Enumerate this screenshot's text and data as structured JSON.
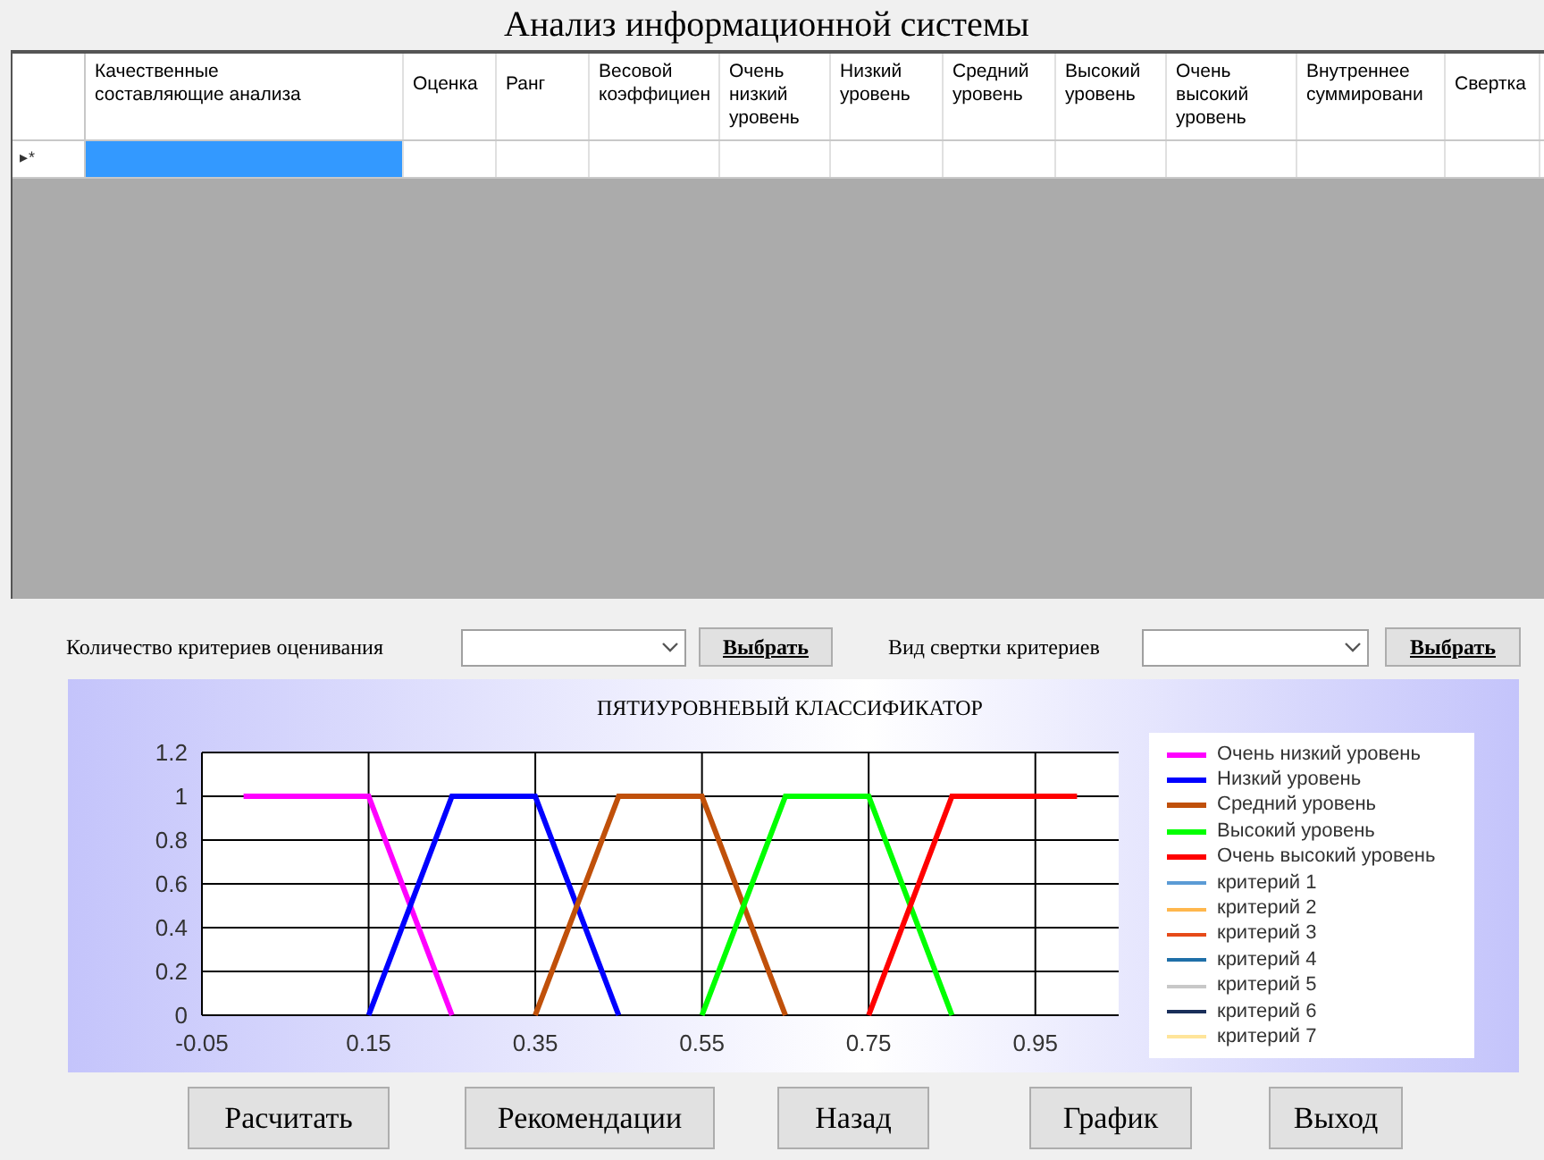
{
  "window": {
    "title": "Анализ информационной системы"
  },
  "grid": {
    "columns": [
      "Качественные\nсоставляющие анализа",
      "Оценка",
      "Ранг",
      "Весовой\nкоэффициен",
      "Очень\nнизкий\nуровень",
      "Низкий\nуровень",
      "Средний\nуровень",
      "Высокий\nуровень",
      "Очень\nвысокий\nуровень",
      "Внутреннее\nсуммировани",
      "Свертка"
    ],
    "new_row": {
      "marker": "▸*",
      "cells": [
        {
          "selected": true
        },
        {
          "selected": false
        },
        {
          "selected": false
        },
        {
          "selected": false
        },
        {
          "selected": false
        },
        {
          "selected": false
        },
        {
          "selected": false
        },
        {
          "selected": false
        },
        {
          "selected": false
        },
        {
          "selected": false
        },
        {
          "selected": false
        }
      ]
    }
  },
  "controls": [
    {
      "label": "Количество критериев оценивания",
      "button": "Выбрать"
    },
    {
      "label": "Вид свертки критериев",
      "button": "Выбрать"
    }
  ],
  "chart": {
    "chart_data": {
      "type": "line",
      "title": "ПЯТИУРОВНЕВЫЙ КЛАССИФИКАТОР",
      "x": [
        0,
        0.15,
        0.25,
        0.35,
        0.45,
        0.55,
        0.65,
        0.75,
        0.85,
        1.0
      ],
      "xlim": [
        -0.05,
        1.05
      ],
      "ylim": [
        0,
        1.2
      ],
      "xticks": [
        -0.05,
        0.15,
        0.35,
        0.55,
        0.75,
        0.95
      ],
      "yticks": [
        0,
        0.2,
        0.4,
        0.6,
        0.8,
        1,
        1.2
      ],
      "grid": true,
      "legend": "right",
      "series": [
        {
          "name": "Очень низкий уровень",
          "color": "#ff00ff",
          "values": [
            1,
            1,
            0,
            null,
            null,
            null,
            null,
            null,
            null,
            null
          ]
        },
        {
          "name": "Низкий уровень",
          "color": "#0000ff",
          "values": [
            null,
            0,
            1,
            1,
            0,
            null,
            null,
            null,
            null,
            null
          ]
        },
        {
          "name": "Средний уровень",
          "color": "#c0500a",
          "values": [
            null,
            null,
            null,
            0,
            1,
            1,
            0,
            null,
            null,
            null
          ]
        },
        {
          "name": "Высокий уровень",
          "color": "#00ff00",
          "values": [
            null,
            null,
            null,
            null,
            null,
            0,
            1,
            1,
            0,
            null
          ]
        },
        {
          "name": "Очень высокий уровень",
          "color": "#ff0000",
          "values": [
            null,
            null,
            null,
            null,
            null,
            null,
            null,
            0,
            1,
            1
          ]
        },
        {
          "name": "критерий 1",
          "color": "#5b9bd5",
          "values": [
            null,
            null,
            null,
            null,
            null,
            null,
            null,
            null,
            null,
            null
          ]
        },
        {
          "name": "критерий 2",
          "color": "#ffb74d",
          "values": [
            null,
            null,
            null,
            null,
            null,
            null,
            null,
            null,
            null,
            null
          ]
        },
        {
          "name": "критерий 3",
          "color": "#e64a19",
          "values": [
            null,
            null,
            null,
            null,
            null,
            null,
            null,
            null,
            null,
            null
          ]
        },
        {
          "name": "критерий 4",
          "color": "#1f6fa8",
          "values": [
            null,
            null,
            null,
            null,
            null,
            null,
            null,
            null,
            null,
            null
          ]
        },
        {
          "name": "критерий 5",
          "color": "#c8c8c8",
          "values": [
            null,
            null,
            null,
            null,
            null,
            null,
            null,
            null,
            null,
            null
          ]
        },
        {
          "name": "критерий 6",
          "color": "#1a2f5a",
          "values": [
            null,
            null,
            null,
            null,
            null,
            null,
            null,
            null,
            null,
            null
          ]
        },
        {
          "name": "критерий 7",
          "color": "#ffe59a",
          "values": [
            null,
            null,
            null,
            null,
            null,
            null,
            null,
            null,
            null,
            null
          ]
        }
      ]
    }
  },
  "buttons": [
    "Расчитать",
    "Рекомендации",
    "Назад",
    "График",
    "Выход"
  ]
}
